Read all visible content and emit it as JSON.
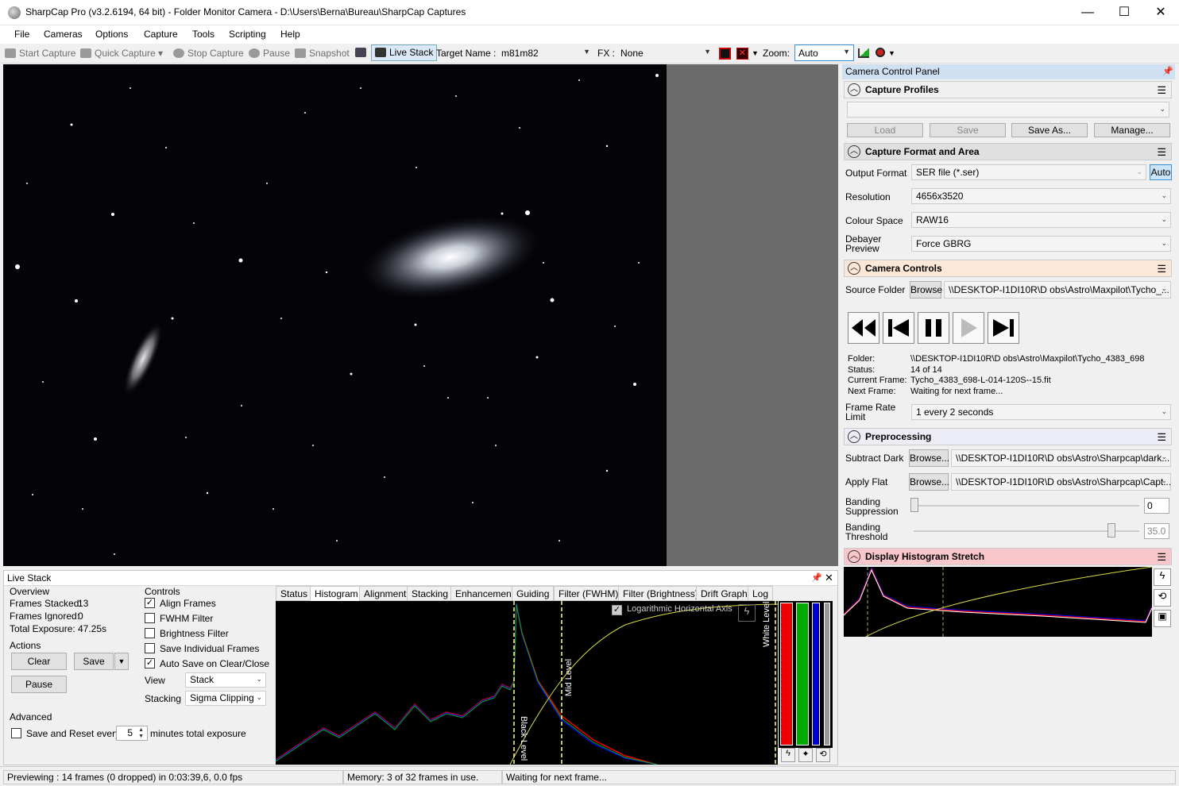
{
  "window": {
    "title": "SharpCap Pro (v3.2.6194, 64 bit) - Folder Monitor Camera - D:\\Users\\Berna\\Bureau\\SharpCap Captures",
    "min": "—",
    "max": "☐",
    "close": "✕"
  },
  "menu": [
    "File",
    "Cameras",
    "Options",
    "Capture",
    "Tools",
    "Scripting",
    "Help"
  ],
  "toolbar": {
    "start_capture": "Start Capture",
    "quick_capture": "Quick Capture",
    "stop_capture": "Stop Capture",
    "pause": "Pause",
    "snapshot": "Snapshot",
    "live_stack": "Live Stack",
    "target_label": "Target Name :",
    "target_value": "m81m82",
    "fx_label": "FX :",
    "fx_value": "None",
    "zoom_label": "Zoom:",
    "zoom_value": "Auto"
  },
  "livestack": {
    "title": "Live Stack",
    "overview": "Overview",
    "frames_stacked_label": "Frames Stacked:",
    "frames_stacked": "13",
    "frames_ignored_label": "Frames Ignored:",
    "frames_ignored": "0",
    "total_exposure_label": "Total Exposure:",
    "total_exposure": "47.25s",
    "actions": "Actions",
    "clear": "Clear",
    "save": "Save",
    "pause": "Pause",
    "controls": "Controls",
    "align_frames": "Align Frames",
    "fwhm_filter": "FWHM Filter",
    "brightness_filter": "Brightness Filter",
    "save_individual": "Save Individual Frames",
    "auto_save": "Auto Save on Clear/Close",
    "view_label": "View",
    "view_value": "Stack",
    "stacking_label": "Stacking",
    "stacking_value": "Sigma Clipping",
    "advanced": "Advanced",
    "save_reset": "Save and Reset every",
    "minutes_value": "5",
    "minutes_label": "minutes total exposure",
    "tabs": [
      "Status",
      "Histogram",
      "Alignment",
      "Stacking",
      "Enhancement",
      "Guiding",
      "Filter (FWHM)",
      "Filter (Brightness)",
      "Drift Graph",
      "Log"
    ],
    "log_axis": "Logarithmic Horizontal Axis",
    "black_level": "Black Level",
    "mid_level": "Mid Level",
    "white_level": "White Level"
  },
  "panel": {
    "title": "Camera Control Panel",
    "capture_profiles": "Capture Profiles",
    "load": "Load",
    "save": "Save",
    "save_as": "Save As...",
    "manage": "Manage...",
    "capture_format": "Capture Format and Area",
    "output_format_label": "Output Format",
    "output_format": "SER file (*.ser)",
    "auto": "Auto",
    "resolution_label": "Resolution",
    "resolution": "4656x3520",
    "colour_space_label": "Colour Space",
    "colour_space": "RAW16",
    "debayer_label1": "Debayer",
    "debayer_label2": "Preview",
    "debayer": "Force GBRG",
    "camera_controls": "Camera Controls",
    "source_folder_label": "Source Folder",
    "browse": "Browse",
    "source_folder": "\\\\DESKTOP-I1DI10R\\D obs\\Astro\\Maxpilot\\Tycho_...",
    "folder_label": "Folder:",
    "folder": "\\\\DESKTOP-I1DI10R\\D obs\\Astro\\Maxpilot\\Tycho_4383_698",
    "status_label": "Status:",
    "status": "14 of 14",
    "current_frame_label": "Current Frame:",
    "current_frame": "Tycho_4383_698-L-014-120S--15.fit",
    "next_frame_label": "Next Frame:",
    "next_frame": "Waiting for next frame...",
    "frame_rate_label1": "Frame Rate",
    "frame_rate_label2": "Limit",
    "frame_rate": "1 every 2 seconds",
    "preprocessing": "Preprocessing",
    "subtract_dark_label": "Subtract Dark",
    "browse2": "Browse...",
    "subtract_dark": "\\\\DESKTOP-I1DI10R\\D obs\\Astro\\Sharpcap\\dark...",
    "apply_flat_label": "Apply Flat",
    "apply_flat": "\\\\DESKTOP-I1DI10R\\D obs\\Astro\\Sharpcap\\Capt...",
    "banding_sup_label1": "Banding",
    "banding_sup_label2": "Suppression",
    "banding_sup": "0",
    "banding_thr_label1": "Banding",
    "banding_thr_label2": "Threshold",
    "banding_thr": "35.0",
    "display_histogram": "Display Histogram Stretch"
  },
  "status": {
    "preview": "Previewing : 14 frames (0 dropped) in 0:03:39,6, 0.0 fps",
    "memory": "Memory: 3 of 32 frames in use.",
    "waiting": "Waiting for next frame..."
  }
}
